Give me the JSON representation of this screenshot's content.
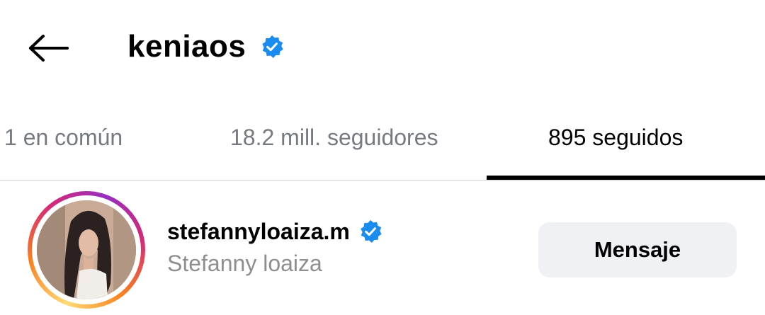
{
  "header": {
    "back_icon": "arrow-left-icon",
    "title": "keniaos",
    "verified_icon": "verified-badge-icon",
    "verified_color": "#1a8cf0"
  },
  "tabs": [
    {
      "label": "1 en común",
      "active": false
    },
    {
      "label": "18.2 mill. seguidores",
      "active": false
    },
    {
      "label": "895 seguidos",
      "active": true
    }
  ],
  "list": [
    {
      "username": "stefannyloaiza.m",
      "full_name": "Stefanny loaiza",
      "verified": true,
      "has_story_ring": true,
      "button_label": "Mensaje"
    }
  ],
  "colors": {
    "text_primary": "#000000",
    "text_secondary": "#757a80",
    "button_bg": "#eff1f5",
    "divider": "#e6e6e6"
  }
}
